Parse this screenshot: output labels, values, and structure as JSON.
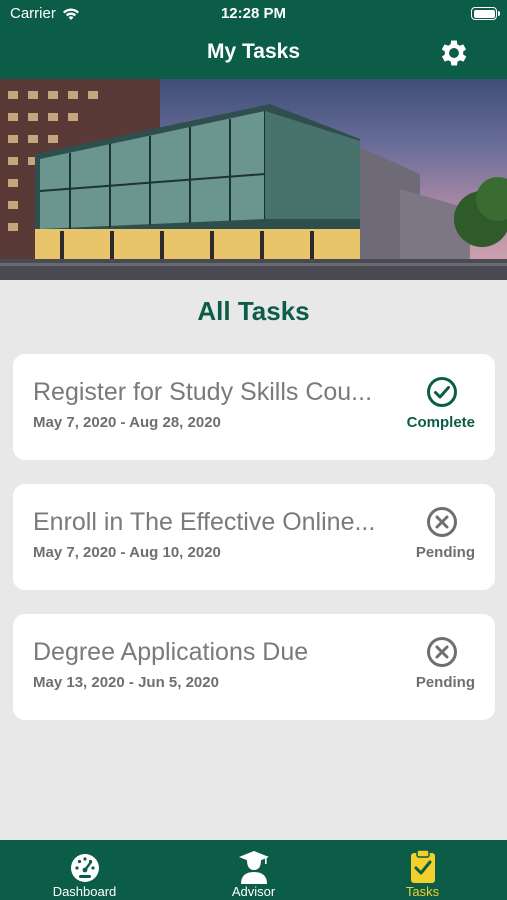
{
  "status_bar": {
    "carrier": "Carrier",
    "time": "12:28 PM"
  },
  "nav": {
    "title": "My Tasks",
    "settings_icon": "gear-icon"
  },
  "section_title": "All Tasks",
  "tasks": [
    {
      "title": "Register for Study Skills Cou...",
      "dates": "May 7, 2020 - Aug 28, 2020",
      "status": "Complete",
      "status_icon": "check-circle-icon"
    },
    {
      "title": "Enroll in The Effective Online...",
      "dates": "May 7, 2020 - Aug 10, 2020",
      "status": "Pending",
      "status_icon": "x-circle-icon"
    },
    {
      "title": "Degree Applications Due",
      "dates": "May 13, 2020 - Jun 5, 2020",
      "status": "Pending",
      "status_icon": "x-circle-icon"
    }
  ],
  "tabs": [
    {
      "label": "Dashboard",
      "icon": "speedometer-icon",
      "active": false
    },
    {
      "label": "Advisor",
      "icon": "graduate-icon",
      "active": false
    },
    {
      "label": "Tasks",
      "icon": "clipboard-check-icon",
      "active": true
    }
  ],
  "colors": {
    "brand": "#0b5d47",
    "active_tab": "#f2cf2b",
    "complete": "#0b5d47",
    "pending": "#6f6f6f"
  }
}
